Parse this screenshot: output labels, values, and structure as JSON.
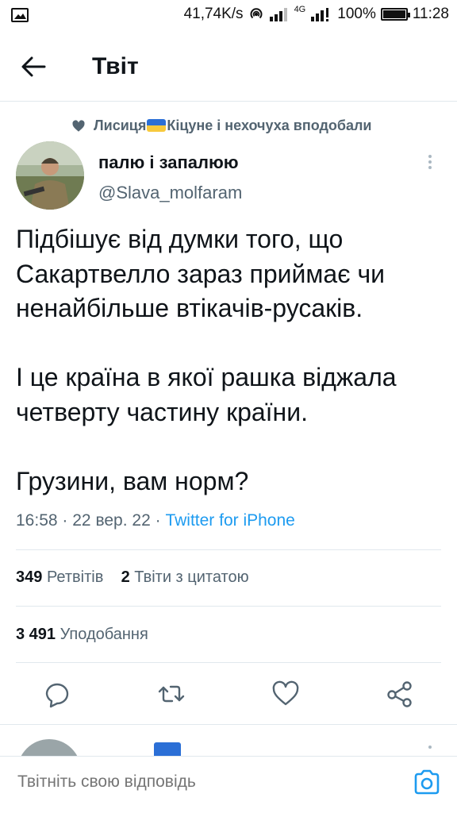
{
  "status_bar": {
    "network_speed": "41,74K/s",
    "network_type": "4G",
    "battery": "100%",
    "battery_level": 1.0,
    "time": "11:28",
    "icons": [
      "image-notification-icon",
      "hotspot-icon",
      "signal-icon",
      "signal-4g-icon",
      "battery-icon"
    ]
  },
  "header": {
    "title": "Твіт",
    "back_icon": "arrow-left-icon"
  },
  "social_context": {
    "prefix": "Лисиця",
    "suffix": "Кіцуне і нехочуха вподобали",
    "icon": "heart-icon"
  },
  "tweet": {
    "author_name": "палю і запалюю",
    "author_handle": "@Slava_molfaram",
    "paragraphs": [
      [
        "Підбішує від думки того, що",
        "Сакартвелло зараз приймає чи",
        "ненайбільше втікачів-русаків."
      ],
      [
        "І це країна в якої рашка віджала",
        "четверту частину країни."
      ],
      [
        "Грузини, вам норм?"
      ]
    ],
    "time": "16:58",
    "date": "22 вер. 22",
    "separator": "·",
    "source": "Twitter for iPhone"
  },
  "stats": {
    "retweets_count": "349",
    "retweets_label": "Ретвітів",
    "quotes_count": "2",
    "quotes_label": "Твіти з цитатою",
    "likes_count": "3 491",
    "likes_label": "Уподобання"
  },
  "actions": [
    {
      "name": "reply-icon"
    },
    {
      "name": "retweet-icon"
    },
    {
      "name": "like-icon"
    },
    {
      "name": "share-icon"
    }
  ],
  "reply_bar": {
    "placeholder": "Твітніть свою відповідь",
    "camera_icon": "camera-icon"
  },
  "colors": {
    "accent": "#1d9bf0",
    "text_primary": "#0f1419",
    "text_secondary": "#536471",
    "divider": "#e1e8ed"
  }
}
